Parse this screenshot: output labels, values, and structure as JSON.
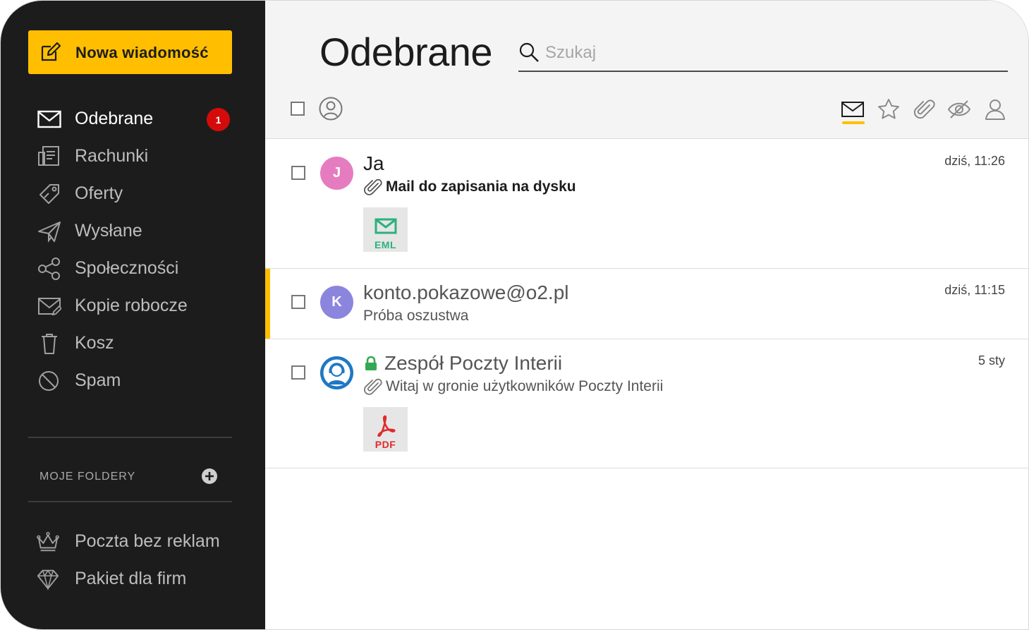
{
  "sidebar": {
    "compose_label": "Nowa wiadomość",
    "items": [
      {
        "label": "Odebrane",
        "icon": "envelope-icon",
        "badge": "1",
        "active": true
      },
      {
        "label": "Rachunki",
        "icon": "receipt-icon"
      },
      {
        "label": "Oferty",
        "icon": "tag-icon"
      },
      {
        "label": "Wysłane",
        "icon": "paper-plane-icon"
      },
      {
        "label": "Społeczności",
        "icon": "share-icon"
      },
      {
        "label": "Kopie robocze",
        "icon": "draft-envelope-icon"
      },
      {
        "label": "Kosz",
        "icon": "trash-icon"
      },
      {
        "label": "Spam",
        "icon": "block-icon"
      }
    ],
    "folders_label": "MOJE FOLDERY",
    "bottom_items": [
      {
        "label": "Poczta bez reklam",
        "icon": "crown-icon"
      },
      {
        "label": "Pakiet dla firm",
        "icon": "diamond-icon"
      }
    ]
  },
  "header": {
    "title": "Odebrane",
    "search_placeholder": "Szukaj",
    "filters": [
      "envelope-icon",
      "star-icon",
      "paperclip-icon",
      "eye-off-icon",
      "user-icon"
    ]
  },
  "messages": [
    {
      "sender": "Ja",
      "initial": "J",
      "avatar_color": "#e67cc0",
      "subject": "Mail do zapisania na dysku",
      "date": "dziś, 11:26",
      "has_attachment": true,
      "attachment_label": "EML",
      "attachment_color": "#2bb17d",
      "unread": false
    },
    {
      "sender": "konto.pokazowe@o2.pl",
      "initial": "K",
      "avatar_color": "#8b85dd",
      "subject": "Próba oszustwa",
      "date": "dziś, 11:15",
      "has_attachment": false,
      "unread": true
    },
    {
      "sender": "Zespół Poczty Interii",
      "subject": "Witaj w gronie użytkowników Poczty Interii",
      "date": "5 sty",
      "has_attachment": true,
      "attachment_label": "PDF",
      "attachment_color": "#e22a2a",
      "verified": true
    }
  ],
  "colors": {
    "accent": "#ffbf00",
    "sidebar_bg": "#1c1c1c",
    "badge": "#d40b0b"
  }
}
